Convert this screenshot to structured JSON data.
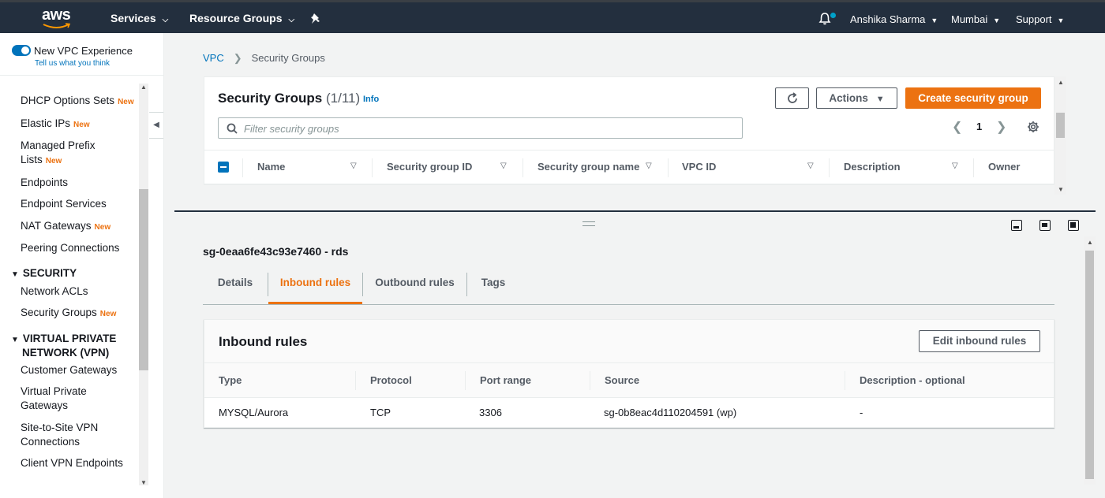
{
  "topnav": {
    "logo": "aws",
    "services_label": "Services",
    "resource_groups_label": "Resource Groups",
    "pin_icon": "pin-icon",
    "bell_icon": "bell-icon",
    "user": "Anshika Sharma",
    "region": "Mumbai",
    "support": "Support"
  },
  "sidebar": {
    "vpc_experience_label": "New VPC Experience",
    "tell_us": "Tell us what you think",
    "new_badge": "New",
    "items": {
      "dhcp": "DHCP Options Sets",
      "eips": "Elastic IPs",
      "prefix_lists_1": "Managed Prefix",
      "prefix_lists_2": "Lists",
      "endpoints": "Endpoints",
      "endpoint_services": "Endpoint Services",
      "nat": "NAT Gateways",
      "peering": "Peering Connections",
      "nacls": "Network ACLs",
      "security_groups": "Security Groups",
      "customer_gw": "Customer Gateways",
      "vpg_1": "Virtual Private",
      "vpg_2": "Gateways",
      "s2s_1": "Site-to-Site VPN",
      "s2s_2": "Connections",
      "client_vpn": "Client VPN Endpoints"
    },
    "headings": {
      "security": "SECURITY",
      "vpn_1": "VIRTUAL PRIVATE",
      "vpn_2": "NETWORK (VPN)"
    }
  },
  "breadcrumb": {
    "root": "VPC",
    "current": "Security Groups"
  },
  "security_groups": {
    "title": "Security Groups",
    "count": "(1/11)",
    "info": "Info",
    "actions_label": "Actions",
    "create_label": "Create security group",
    "search_placeholder": "Filter security groups",
    "page": "1",
    "columns": [
      "Name",
      "Security group ID",
      "Security group name",
      "VPC ID",
      "Description",
      "Owner"
    ]
  },
  "detail": {
    "title": "sg-0eaa6fe43c93e7460 - rds",
    "tabs": [
      "Details",
      "Inbound rules",
      "Outbound rules",
      "Tags"
    ],
    "active_tab": "Inbound rules"
  },
  "inbound_rules": {
    "title": "Inbound rules",
    "edit_label": "Edit inbound rules",
    "columns": [
      "Type",
      "Protocol",
      "Port range",
      "Source",
      "Description - optional"
    ],
    "rows": [
      [
        "MYSQL/Aurora",
        "TCP",
        "3306",
        "sg-0b8eac4d110204591 (wp)",
        "-"
      ]
    ]
  },
  "colors": {
    "nav_bg": "#232f3e",
    "accent_orange": "#ec7211",
    "link_blue": "#0073bb"
  }
}
